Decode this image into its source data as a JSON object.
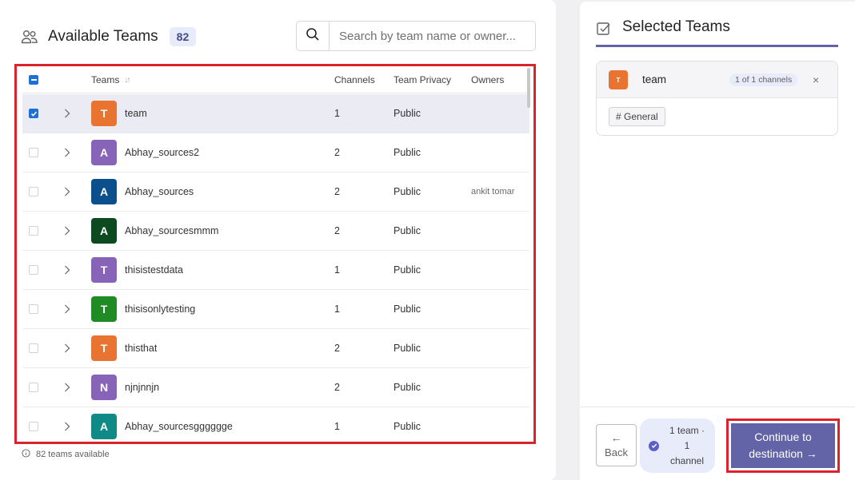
{
  "left": {
    "title": "Available Teams",
    "count": "82",
    "search_placeholder": "Search by team name or owner...",
    "columns": {
      "teams": "Teams",
      "sort_icon": "↓↑",
      "channels": "Channels",
      "privacy": "Team Privacy",
      "owners": "Owners"
    },
    "rows": [
      {
        "initial": "T",
        "name": "team",
        "channels": "1",
        "privacy": "Public",
        "owners": "",
        "color": "#e97331",
        "checked": true
      },
      {
        "initial": "A",
        "name": "Abhay_sources2",
        "channels": "2",
        "privacy": "Public",
        "owners": "",
        "color": "#8764b8",
        "checked": false
      },
      {
        "initial": "A",
        "name": "Abhay_sources",
        "channels": "2",
        "privacy": "Public",
        "owners": "ankit tomar",
        "color": "#0b508c",
        "checked": false
      },
      {
        "initial": "A",
        "name": "Abhay_sourcesmmm",
        "channels": "2",
        "privacy": "Public",
        "owners": "",
        "color": "#0d4a1f",
        "checked": false
      },
      {
        "initial": "T",
        "name": "thisistestdata",
        "channels": "1",
        "privacy": "Public",
        "owners": "",
        "color": "#8764b8",
        "checked": false
      },
      {
        "initial": "T",
        "name": "thisisonlytesting",
        "channels": "1",
        "privacy": "Public",
        "owners": "",
        "color": "#1e8b24",
        "checked": false
      },
      {
        "initial": "T",
        "name": "thisthat",
        "channels": "2",
        "privacy": "Public",
        "owners": "",
        "color": "#e97331",
        "checked": false
      },
      {
        "initial": "N",
        "name": "njnjnnjn",
        "channels": "2",
        "privacy": "Public",
        "owners": "",
        "color": "#8764b8",
        "checked": false
      },
      {
        "initial": "A",
        "name": "Abhay_sourcesgggggge",
        "channels": "1",
        "privacy": "Public",
        "owners": "",
        "color": "#0f8a87",
        "checked": false
      }
    ],
    "footnote": "82 teams available"
  },
  "right": {
    "title": "Selected Teams",
    "selected": {
      "initial": "T",
      "name": "team",
      "badge": "1 of 1 channels",
      "close": "×",
      "channel": "# General"
    },
    "back_label": "Back",
    "back_arrow": "←",
    "summary_lines": [
      "1 team ·",
      "1",
      "channel"
    ],
    "continue_line1": "Continue to",
    "continue_line2": "destination →"
  },
  "colors": {
    "accent": "#6264a7",
    "highlight_outline": "#d9232d",
    "checkbox": "#1f6fd6"
  },
  "icons": [
    "people-icon",
    "search-icon",
    "sort-icon",
    "chevron-right-icon",
    "checkbox-square-icon",
    "info-icon",
    "close-icon",
    "back-arrow-icon",
    "check-circle-icon"
  ]
}
